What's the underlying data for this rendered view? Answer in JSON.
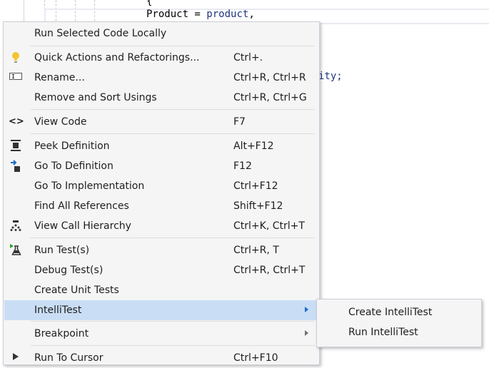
{
  "editor": {
    "line1": "{",
    "line2_prop": "Product = ",
    "line2_value": "product",
    "line2_end": ",",
    "line3": "ity;"
  },
  "menu": {
    "items": [
      {
        "label": "Run Selected Code Locally",
        "shortcut": "",
        "icon": ""
      },
      {
        "label": "Quick Actions and Refactorings...",
        "shortcut": "Ctrl+.",
        "icon": "lightbulb-icon"
      },
      {
        "label": "Rename...",
        "shortcut": "Ctrl+R, Ctrl+R",
        "icon": "rename-icon"
      },
      {
        "label": "Remove and Sort Usings",
        "shortcut": "Ctrl+R, Ctrl+G",
        "icon": ""
      },
      {
        "label": "View Code",
        "shortcut": "F7",
        "icon": "code-brackets-icon"
      },
      {
        "label": "Peek Definition",
        "shortcut": "Alt+F12",
        "icon": "peek-definition-icon"
      },
      {
        "label": "Go To Definition",
        "shortcut": "F12",
        "icon": "go-to-definition-icon"
      },
      {
        "label": "Go To Implementation",
        "shortcut": "Ctrl+F12",
        "icon": ""
      },
      {
        "label": "Find All References",
        "shortcut": "Shift+F12",
        "icon": ""
      },
      {
        "label": "View Call Hierarchy",
        "shortcut": "Ctrl+K, Ctrl+T",
        "icon": "call-hierarchy-icon"
      },
      {
        "label": "Run Test(s)",
        "shortcut": "Ctrl+R, T",
        "icon": "run-test-icon"
      },
      {
        "label": "Debug Test(s)",
        "shortcut": "Ctrl+R, Ctrl+T",
        "icon": ""
      },
      {
        "label": "Create Unit Tests",
        "shortcut": "",
        "icon": ""
      },
      {
        "label": "IntelliTest",
        "shortcut": "",
        "icon": "",
        "submenu": true,
        "highlighted": true
      },
      {
        "label": "Breakpoint",
        "shortcut": "",
        "icon": "",
        "submenu": true
      },
      {
        "label": "Run To Cursor",
        "shortcut": "Ctrl+F10",
        "icon": "run-to-cursor-icon"
      }
    ]
  },
  "submenu": {
    "items": [
      {
        "label": "Create IntelliTest"
      },
      {
        "label": "Run IntelliTest"
      }
    ]
  },
  "colors": {
    "highlight": "#c9def5",
    "menu_bg": "#f5f5f5",
    "code_identifier": "#1f377f"
  }
}
